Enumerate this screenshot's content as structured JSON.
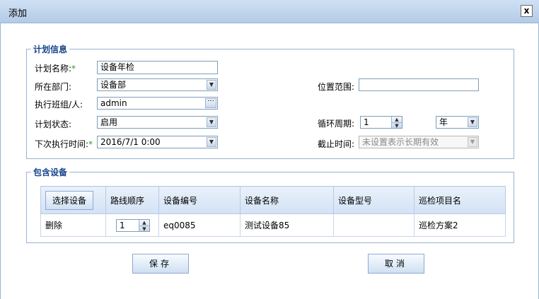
{
  "dialog": {
    "title": "添加",
    "close_label": "x"
  },
  "plan_info": {
    "legend": "计划信息",
    "name_label": "计划名称:",
    "name_value": "设备年检",
    "dept_label": "所在部门:",
    "dept_value": "设备部",
    "location_label": "位置范围:",
    "location_value": "",
    "executor_label": "执行班组/人:",
    "executor_value": "admin",
    "status_label": "计划状态:",
    "status_value": "启用",
    "cycle_label": "循环周期:",
    "cycle_value": "1",
    "cycle_unit": "年",
    "next_time_label": "下次执行时间:",
    "next_time_value": "2016/7/1 0:00",
    "end_time_label": "截止时间:",
    "end_time_placeholder": "未设置表示长期有效",
    "required_mark": "*"
  },
  "devices": {
    "legend": "包含设备",
    "select_button": "选择设备",
    "columns": [
      "路线顺序",
      "设备编号",
      "设备名称",
      "设备型号",
      "巡检项目名"
    ],
    "rows": [
      {
        "action": "删除",
        "order": "1",
        "code": "eq0085",
        "name": "测试设备85",
        "model": "",
        "item": "巡检方案2"
      }
    ]
  },
  "buttons": {
    "save": "保存",
    "cancel": "取消"
  }
}
